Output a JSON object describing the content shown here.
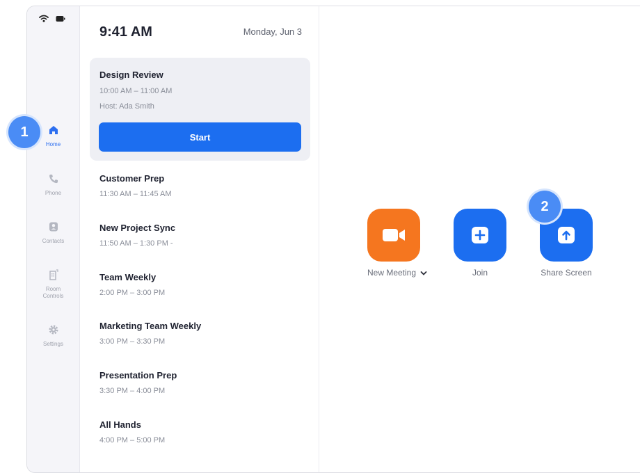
{
  "sidebar": {
    "items": [
      {
        "label": "Home",
        "icon": "home-icon",
        "active": true
      },
      {
        "label": "Phone",
        "icon": "phone-icon"
      },
      {
        "label": "Contacts",
        "icon": "contacts-icon"
      },
      {
        "label": "Room Controls",
        "icon": "room-controls-icon"
      },
      {
        "label": "Settings",
        "icon": "gear-icon"
      }
    ]
  },
  "header": {
    "time": "9:41 AM",
    "date": "Monday, Jun 3"
  },
  "current_meeting": {
    "title": "Design Review",
    "time": "10:00 AM – 11:00 AM",
    "host": "Host: Ada Smith",
    "start_label": "Start"
  },
  "meetings": [
    {
      "title": "Customer Prep",
      "time": "11:30 AM – 11:45 AM"
    },
    {
      "title": "New Project Sync",
      "time": "11:50 AM – 1:30 PM -"
    },
    {
      "title": "Team Weekly",
      "time": "2:00 PM – 3:00 PM"
    },
    {
      "title": "Marketing Team Weekly",
      "time": "3:00 PM – 3:30 PM"
    },
    {
      "title": "Presentation Prep",
      "time": "3:30 PM – 4:00 PM"
    },
    {
      "title": "All Hands",
      "time": "4:00 PM – 5:00 PM"
    }
  ],
  "actions": {
    "new_meeting": {
      "label": "New Meeting",
      "color": "#f5761f"
    },
    "join": {
      "label": "Join",
      "color": "#1c6ef0"
    },
    "share_screen": {
      "label": "Share Screen",
      "color": "#1c6ef0"
    }
  },
  "badges": {
    "one": "1",
    "two": "2"
  },
  "colors": {
    "accent": "#1c6ef0",
    "badge": "#4a8cf5",
    "orange": "#f5761f"
  }
}
